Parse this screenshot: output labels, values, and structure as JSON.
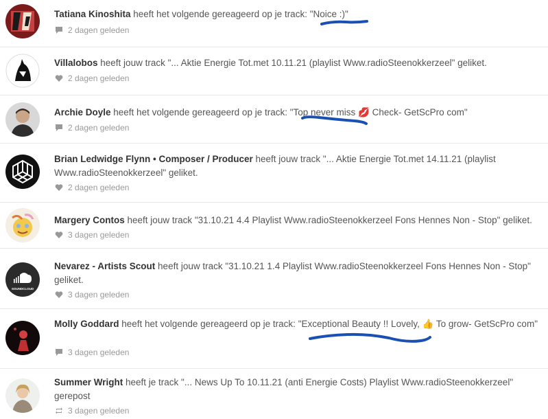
{
  "items": [
    {
      "user": "Tatiana Kinoshita",
      "action": " heeft het volgende gereageerd op je track: ",
      "quote": "\"Noice :)\"",
      "time": "2 dagen geleden",
      "meta_icon": "comment-icon"
    },
    {
      "user": "Villalobos",
      "action": " heeft jouw track \"... Aktie Energie Tot.met 10.11.21 (playlist Www.radioSteenokkerzeel\" geliket.",
      "quote": "",
      "time": "2 dagen geleden",
      "meta_icon": "heart-icon"
    },
    {
      "user": "Archie Doyle",
      "action": " heeft het volgende gereageerd op je track: ",
      "quote": "\"Top never miss 💋 Check- GetScPro com\"",
      "time": "2 dagen geleden",
      "meta_icon": "comment-icon"
    },
    {
      "user": "Brian Ledwidge Flynn • Composer / Producer",
      "action": " heeft jouw track \"... Aktie Energie Tot.met 14.11.21 (playlist Www.radioSteenokkerzeel\" geliket.",
      "quote": "",
      "time": "2 dagen geleden",
      "meta_icon": "heart-icon"
    },
    {
      "user": "Margery Contos",
      "action": " heeft jouw track \"31.10.21 4.4 Playlist Www.radioSteenokkerzeel Fons Hennes Non - Stop\" geliket.",
      "quote": "",
      "time": "3 dagen geleden",
      "meta_icon": "heart-icon"
    },
    {
      "user": "Nevarez - Artists Scout",
      "action": " heeft jouw track \"31.10.21 1.4 Playlist Www.radioSteenokkerzeel Fons Hennes Non - Stop\" geliket.",
      "quote": "",
      "time": "3 dagen geleden",
      "meta_icon": "heart-icon"
    },
    {
      "user": "Molly Goddard",
      "action": " heeft het volgende gereageerd op je track: ",
      "quote": "\"Exceptional Beauty !! Lovely, 👍 To grow- GetScPro com\"",
      "time": "3 dagen geleden",
      "meta_icon": "comment-icon"
    },
    {
      "user": "Summer Wright",
      "action": " heeft je track \"... News Up To 10.11.21 (anti Energie Costs) Playlist Www.radioSteenokkerzeel\" gerepost",
      "quote": "",
      "time": "3 dagen geleden",
      "meta_icon": "repost-icon"
    }
  ],
  "avatar_labels": {
    "soundcloud": "SOUNDCLOUD"
  },
  "colors": {
    "marker": "#1a4fb3",
    "user": "#333333",
    "text": "#555555",
    "meta": "#999999"
  }
}
